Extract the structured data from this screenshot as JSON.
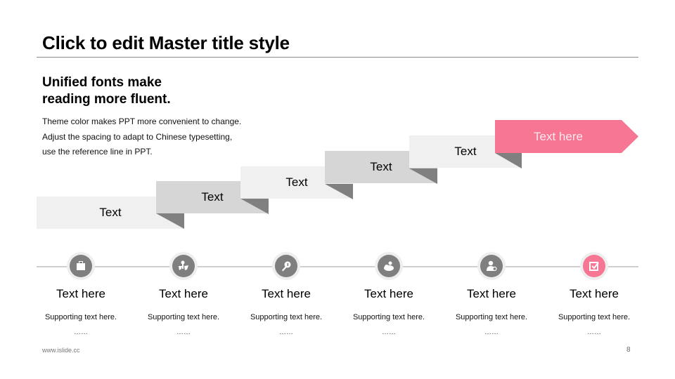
{
  "slide": {
    "title": "Click to edit Master title style",
    "subhead_lines": [
      "Unified fonts make",
      "reading more fluent."
    ],
    "body_lines": [
      "Theme color makes PPT more convenient to change.",
      "Adjust the spacing to adapt to Chinese typesetting,",
      "use the reference line in PPT."
    ],
    "steps": [
      {
        "label": "Text"
      },
      {
        "label": "Text"
      },
      {
        "label": "Text"
      },
      {
        "label": "Text"
      },
      {
        "label": "Text"
      },
      {
        "label": "Text here"
      }
    ],
    "timeline": [
      {
        "icon": "briefcase-icon",
        "title": "Text here",
        "supporting": "Supporting text here.",
        "ellipsis": "……"
      },
      {
        "icon": "people-stars-icon",
        "title": "Text here",
        "supporting": "Supporting text here.",
        "ellipsis": "……"
      },
      {
        "icon": "key-icon",
        "title": "Text here",
        "supporting": "Supporting text here.",
        "ellipsis": "……"
      },
      {
        "icon": "cloud-user-icon",
        "title": "Text here",
        "supporting": "Supporting text here.",
        "ellipsis": "……"
      },
      {
        "icon": "user-settings-icon",
        "title": "Text here",
        "supporting": "Supporting text here.",
        "ellipsis": "……"
      },
      {
        "icon": "checkbox-icon",
        "title": "Text here",
        "supporting": "Supporting text here.",
        "ellipsis": "……"
      }
    ],
    "footer_url": "www.islide.cc",
    "page_number": "8",
    "colors": {
      "accent": "#f67693",
      "step_light": "#f0f0f0",
      "step_mid": "#d6d6d6",
      "fold": "#808080",
      "icon_gray": "#7f7f7f"
    }
  }
}
